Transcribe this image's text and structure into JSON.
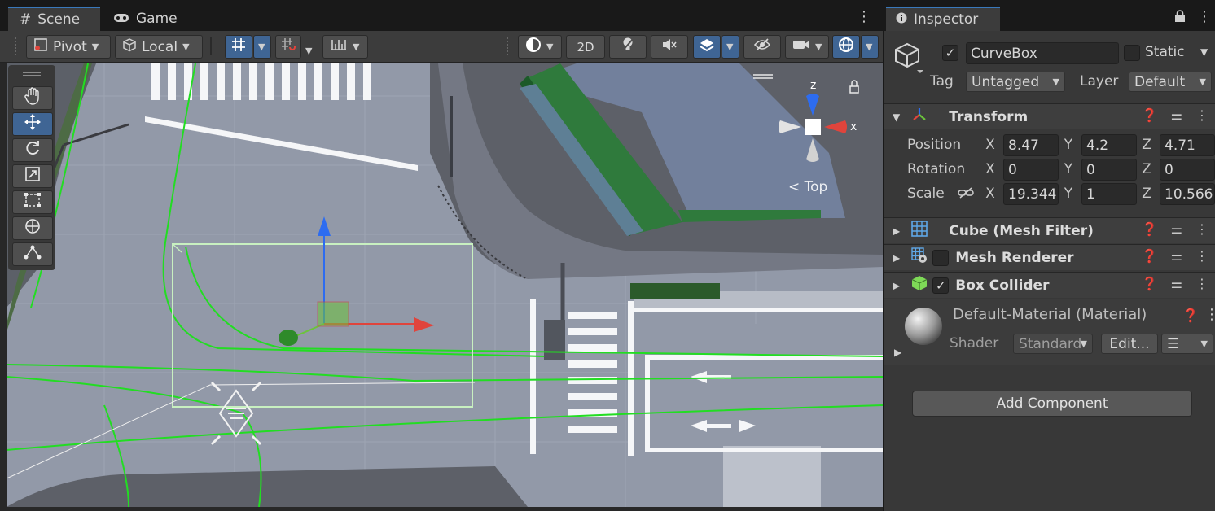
{
  "scene": {
    "tabs": [
      {
        "label": "Scene",
        "icon": "grid-icon"
      },
      {
        "label": "Game",
        "icon": "gamepad-icon"
      }
    ],
    "toolbar": {
      "pivot_label": "Pivot",
      "local_label": "Local",
      "mode_2d_label": "2D"
    },
    "orientation_label": "Top",
    "gizmo_axes": {
      "x": "x",
      "z": "z"
    }
  },
  "inspector": {
    "tab_label": "Inspector",
    "object": {
      "active": true,
      "name": "CurveBox",
      "static_label": "Static",
      "tag_label": "Tag",
      "tag_value": "Untagged",
      "layer_label": "Layer",
      "layer_value": "Default"
    },
    "transform": {
      "title": "Transform",
      "position_label": "Position",
      "rotation_label": "Rotation",
      "scale_label": "Scale",
      "axis_x": "X",
      "axis_y": "Y",
      "axis_z": "Z",
      "position": {
        "x": "8.47",
        "y": "4.2",
        "z": "4.71"
      },
      "rotation": {
        "x": "0",
        "y": "0",
        "z": "0"
      },
      "scale": {
        "x": "19.344",
        "y": "1",
        "z": "10.566"
      }
    },
    "components": [
      {
        "title": "Cube (Mesh Filter)",
        "icon": "mesh-filter-icon"
      },
      {
        "title": "Mesh Renderer",
        "icon": "mesh-renderer-icon"
      },
      {
        "title": "Box Collider",
        "icon": "box-collider-icon"
      }
    ],
    "material": {
      "title": "Default-Material (Material)",
      "shader_label": "Shader",
      "shader_value": "Standard",
      "edit_label": "Edit..."
    },
    "add_component_label": "Add Component"
  },
  "colors": {
    "accent_blue": "#3f6594",
    "tab_highlight": "#3a79bb",
    "road": "#9299a8",
    "spline_green": "#22dd22",
    "axis_x": "#e0443c",
    "axis_y": "#6cc33c",
    "axis_z": "#2d6cf0"
  }
}
